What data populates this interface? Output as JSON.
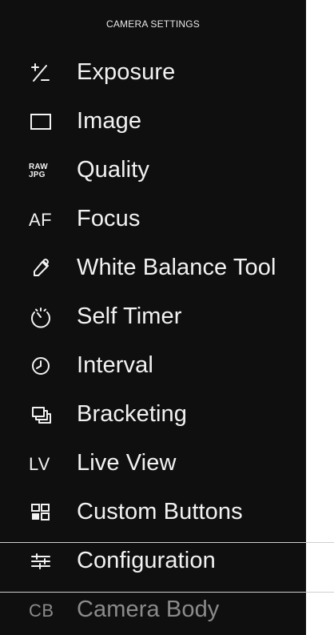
{
  "header": {
    "title": "CAMERA SETTINGS"
  },
  "menu": {
    "items": [
      {
        "label": "Exposure",
        "icon": "plus-minus-icon",
        "state": "normal"
      },
      {
        "label": "Image",
        "icon": "frame-icon",
        "state": "normal"
      },
      {
        "label": "Quality",
        "icon": "raw-jpg-icon",
        "state": "normal",
        "icon_text_top": "RAW",
        "icon_text_bottom": "JPG"
      },
      {
        "label": "Focus",
        "icon": "af-icon",
        "state": "normal",
        "icon_text": "AF"
      },
      {
        "label": "White Balance Tool",
        "icon": "eyedropper-icon",
        "state": "normal"
      },
      {
        "label": "Self Timer",
        "icon": "self-timer-icon",
        "state": "normal"
      },
      {
        "label": "Interval",
        "icon": "interval-clock-icon",
        "state": "normal"
      },
      {
        "label": "Bracketing",
        "icon": "bracketing-icon",
        "state": "normal"
      },
      {
        "label": "Live View",
        "icon": "lv-icon",
        "state": "normal",
        "icon_text": "LV"
      },
      {
        "label": "Custom Buttons",
        "icon": "custom-buttons-icon",
        "state": "normal"
      },
      {
        "label": "Configuration",
        "icon": "sliders-icon",
        "state": "selected"
      },
      {
        "label": "Camera Body",
        "icon": "cb-icon",
        "state": "disabled",
        "icon_text": "CB"
      }
    ]
  },
  "colors": {
    "panel_bg": "#0f0f0f",
    "text": "#f2f2f2",
    "disabled_text": "#8b8b8b",
    "separator": "#cfcfcf"
  }
}
